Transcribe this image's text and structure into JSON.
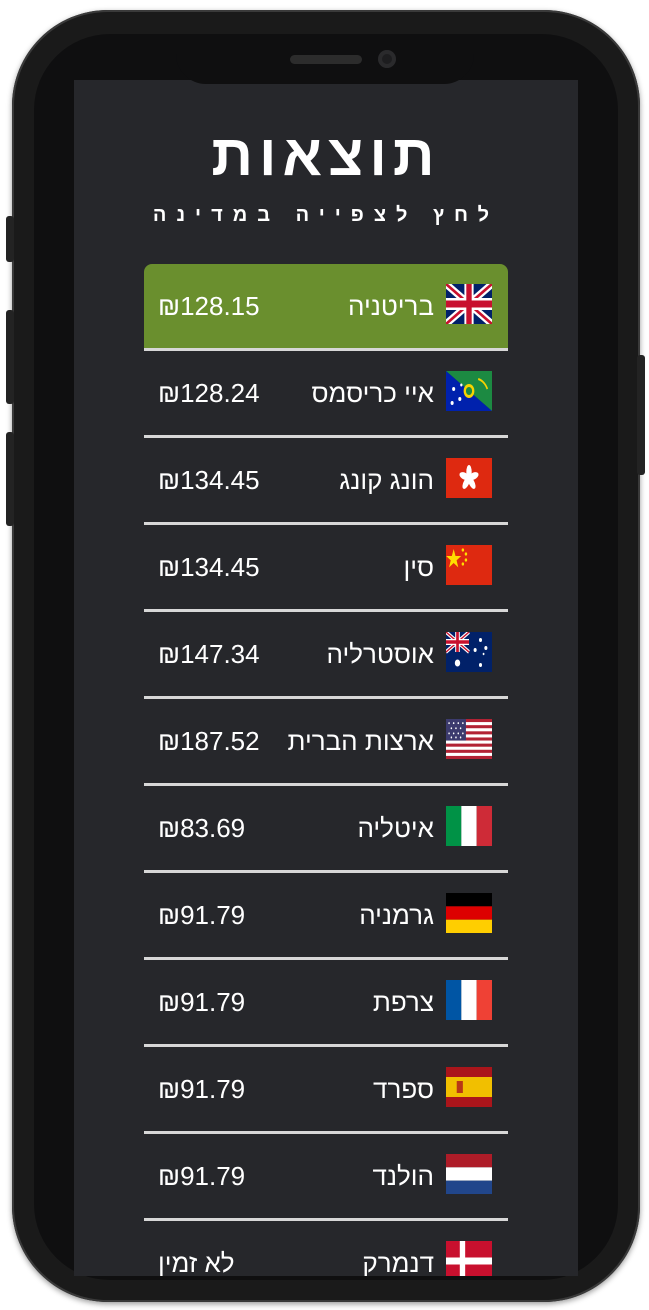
{
  "title": "תוצאות",
  "subtitle": "לחץ לצפייה במדינה",
  "colors": {
    "selected_row": "#6a8f2e",
    "background": "#26272b",
    "divider": "#d7d7d7"
  },
  "rows": [
    {
      "country": "בריטניה",
      "price": "₪128.15",
      "flag": "uk-flag",
      "selected": true
    },
    {
      "country": "איי כריסמס",
      "price": "₪128.24",
      "flag": "christmas-island-flag"
    },
    {
      "country": "הונג קונג",
      "price": "₪134.45",
      "flag": "hong-kong-flag"
    },
    {
      "country": "סין",
      "price": "₪134.45",
      "flag": "china-flag"
    },
    {
      "country": "אוסטרליה",
      "price": "₪147.34",
      "flag": "australia-flag"
    },
    {
      "country": "ארצות הברית",
      "price": "₪187.52",
      "flag": "usa-flag"
    },
    {
      "country": "איטליה",
      "price": "₪83.69",
      "flag": "italy-flag"
    },
    {
      "country": "גרמניה",
      "price": "₪91.79",
      "flag": "germany-flag"
    },
    {
      "country": "צרפת",
      "price": "₪91.79",
      "flag": "france-flag"
    },
    {
      "country": "ספרד",
      "price": "₪91.79",
      "flag": "spain-flag"
    },
    {
      "country": "הולנד",
      "price": "₪91.79",
      "flag": "netherlands-flag"
    },
    {
      "country": "דנמרק",
      "price": "לא זמין",
      "flag": "denmark-flag"
    }
  ]
}
